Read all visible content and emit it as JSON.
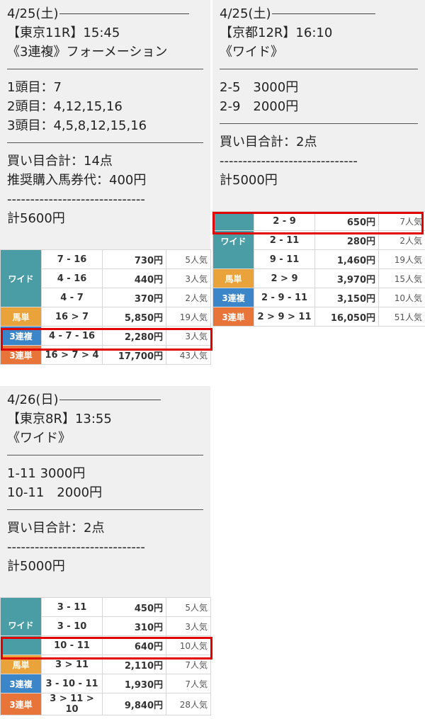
{
  "card1": {
    "date": "4/25(土)",
    "race": "【東京11R】15:45",
    "bet_type": "《3連複》フォーメーション",
    "picks": [
      "1頭目：7",
      "2頭目：4,12,15,16",
      "3頭目：4,5,8,12,15,16"
    ],
    "summary": [
      "買い目合計：14点",
      "推奨購入馬券代：400円"
    ],
    "dashes": "------------------------------",
    "total": "計5600円",
    "results": {
      "wide_label": "ワイド",
      "wide_rows": [
        {
          "nums": "7 - 16",
          "pay": "730円",
          "pop": "5人気"
        },
        {
          "nums": "4 - 16",
          "pay": "440円",
          "pop": "3人気"
        },
        {
          "nums": "4 - 7",
          "pay": "370円",
          "pop": "2人気"
        }
      ],
      "umatan": {
        "label": "馬単",
        "nums": "16 > 7",
        "pay": "5,850円",
        "pop": "19人気"
      },
      "sanfuku": {
        "label": "3連複",
        "nums": "4 - 7 - 16",
        "pay": "2,280円",
        "pop": "3人気"
      },
      "santan": {
        "label": "3連単",
        "nums": "16 > 7 > 4",
        "pay": "17,700円",
        "pop": "43人気"
      }
    }
  },
  "card2": {
    "date": "4/25(土)",
    "race": "【京都12R】16:10",
    "bet_type": "《ワイド》",
    "picks": [
      "2-5　3000円",
      "2-9　2000円"
    ],
    "summary": [
      "買い目合計：2点"
    ],
    "dashes": "------------------------------",
    "total": "計5000円",
    "results": {
      "wide_label": "ワイド",
      "wide_rows": [
        {
          "nums": "2 - 9",
          "pay": "650円",
          "pop": "7人気"
        },
        {
          "nums": "2 - 11",
          "pay": "280円",
          "pop": "2人気"
        },
        {
          "nums": "9 - 11",
          "pay": "1,460円",
          "pop": "19人気"
        }
      ],
      "umatan": {
        "label": "馬単",
        "nums": "2 > 9",
        "pay": "3,970円",
        "pop": "15人気"
      },
      "sanfuku": {
        "label": "3連複",
        "nums": "2 - 9 - 11",
        "pay": "3,150円",
        "pop": "10人気"
      },
      "santan": {
        "label": "3連単",
        "nums": "2 > 9 > 11",
        "pay": "16,050円",
        "pop": "51人気"
      }
    }
  },
  "card3": {
    "date": "4/26(日)",
    "race": "【東京8R】13:55",
    "bet_type": "《ワイド》",
    "picks": [
      "1-11 3000円",
      "10-11　2000円"
    ],
    "summary": [
      "買い目合計：2点"
    ],
    "dashes": "------------------------------",
    "total": "計5000円",
    "results": {
      "wide_label": "ワイド",
      "wide_rows": [
        {
          "nums": "3 - 11",
          "pay": "450円",
          "pop": "5人気"
        },
        {
          "nums": "3 - 10",
          "pay": "310円",
          "pop": "3人気"
        },
        {
          "nums": "10 - 11",
          "pay": "640円",
          "pop": "10人気"
        }
      ],
      "umatan": {
        "label": "馬単",
        "nums": "3 > 11",
        "pay": "2,110円",
        "pop": "7人気"
      },
      "sanfuku": {
        "label": "3連複",
        "nums": "3 - 10 - 11",
        "pay": "1,930円",
        "pop": "7人気"
      },
      "santan": {
        "label": "3連単",
        "nums": "3 > 11 > 10",
        "pay": "9,840円",
        "pop": "28人気"
      }
    }
  },
  "colors": {
    "wide": "#4b9da5",
    "umatan": "#eaa23a",
    "sanfuku": "#3a86c8",
    "santan": "#e8743a",
    "highlight": "#e00000",
    "memo_bg": "#f0f0f0"
  }
}
